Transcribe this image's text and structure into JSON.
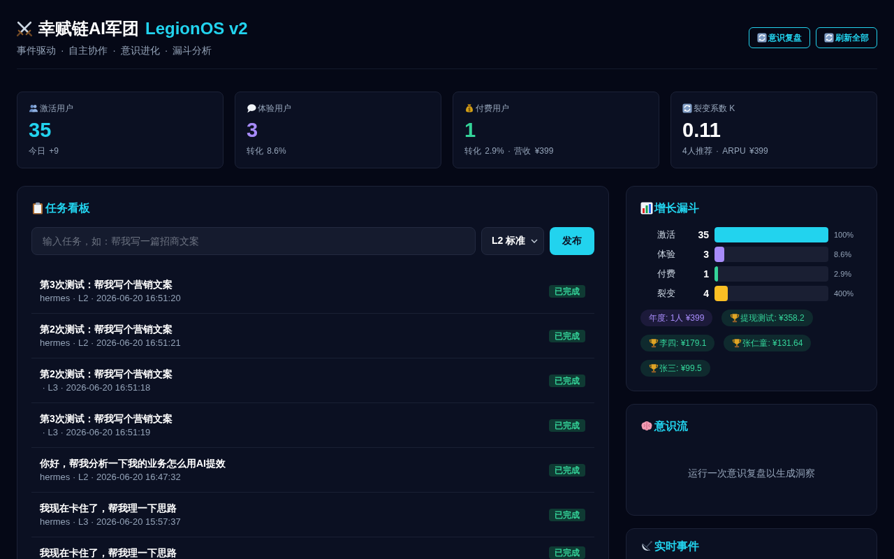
{
  "header": {
    "title": "幸赋链AI军团",
    "product": "LegionOS v2",
    "subtitle": "事件驱动 · 自主协作 · 意识进化 · 漏斗分析",
    "buttons": [
      {
        "label": "意识复盘"
      },
      {
        "label": "刷新全部"
      }
    ]
  },
  "stats": [
    {
      "label": "激活用户",
      "value": "35",
      "note": "今日 +9",
      "color": "#22d3ee"
    },
    {
      "label": "体验用户",
      "value": "3",
      "note": "转化 8.6%",
      "color": "#a78bfa"
    },
    {
      "label": "付费用户",
      "value": "1",
      "note": "转化 2.9% · 营收 ¥399",
      "color": "#34d399"
    },
    {
      "label": "裂变系数 K",
      "value": "0.11",
      "note": "4人推荐 · ARPU ¥399",
      "color": "#ffffff"
    }
  ],
  "task_board": {
    "title": "任务看板",
    "input": {
      "placeholder": "输入任务，如：帮我写一篇招商文案"
    },
    "level_select": {
      "value": "L2 标准"
    },
    "submit_button": "发布",
    "tasks": [
      {
        "title": "第3次测试：帮我写个营销文案",
        "meta": "hermes · L2 · 2026-06-20 16:51:20",
        "status": "已完成"
      },
      {
        "title": "第2次测试：帮我写个营销文案",
        "meta": "hermes · L2 · 2026-06-20 16:51:21",
        "status": "已完成"
      },
      {
        "title": "第2次测试：帮我写个营销文案",
        "meta": " · L3 · 2026-06-20 16:51:18",
        "status": "已完成"
      },
      {
        "title": "第3次测试：帮我写个营销文案",
        "meta": " · L3 · 2026-06-20 16:51:19",
        "status": "已完成"
      },
      {
        "title": "你好，帮我分析一下我的业务怎么用AI提效",
        "meta": "hermes · L2 · 2026-06-20 16:47:32",
        "status": "已完成"
      },
      {
        "title": "我现在卡住了，帮我理一下思路",
        "meta": "hermes · L3 · 2026-06-20 15:57:37",
        "status": "已完成"
      },
      {
        "title": "我现在卡住了，帮我理一下思路",
        "status": "已完成"
      }
    ]
  },
  "funnel": {
    "title": "增长漏斗",
    "stages": [
      {
        "label": "激活",
        "count": "35",
        "level": 1,
        "percent": "100%",
        "color": "#22d3ee"
      },
      {
        "label": "体验",
        "count": "3",
        "level": 0.086,
        "percent": "8.6%",
        "color": "#a78bfa"
      },
      {
        "label": "付费",
        "count": "1",
        "level": 0.029,
        "percent": "2.9%",
        "color": "#34d399"
      },
      {
        "label": "裂变",
        "count": "4",
        "level": 0.114,
        "percent": "400%",
        "color": "#fbbf24"
      }
    ],
    "chips": [
      {
        "kind": "plan",
        "text": "年度: 1人 ¥399"
      },
      {
        "kind": "reward",
        "text": "提现测试: ¥358.2"
      },
      {
        "kind": "reward",
        "text": "李四: ¥179.1"
      },
      {
        "kind": "reward",
        "text": "张仁童: ¥131.64"
      },
      {
        "kind": "reward",
        "text": "张三: ¥99.5"
      }
    ]
  },
  "consciousness": {
    "title": "意识流",
    "empty_text": "运行一次意识复盘以生成洞察"
  },
  "events": {
    "title": "实时事件"
  }
}
